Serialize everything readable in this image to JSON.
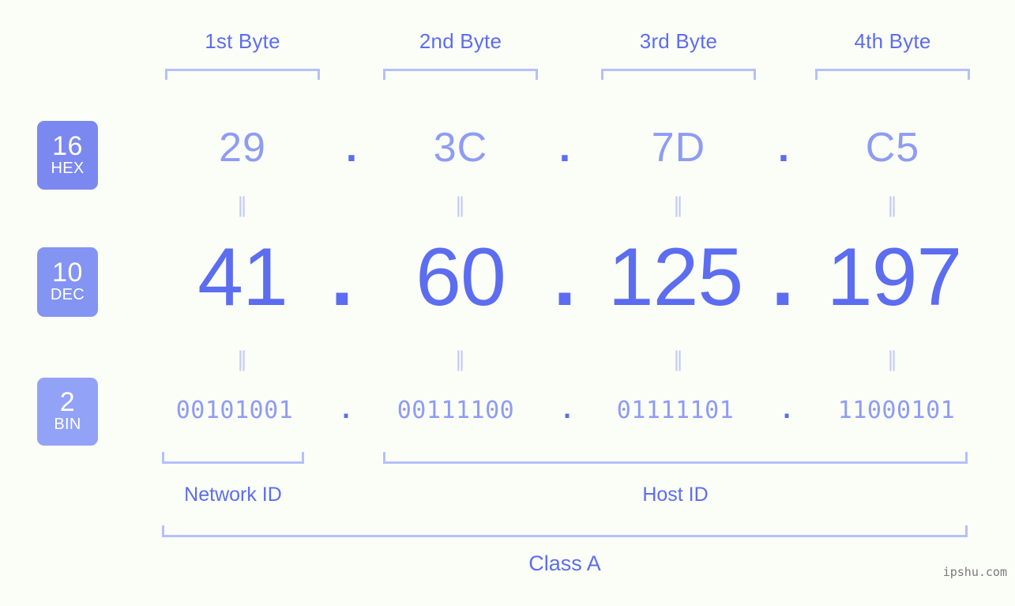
{
  "headers": [
    {
      "label": "1st Byte"
    },
    {
      "label": "2nd Byte"
    },
    {
      "label": "3rd Byte"
    },
    {
      "label": "4th Byte"
    }
  ],
  "bases": [
    {
      "num": "16",
      "abbr": "HEX",
      "color": "#7b88ef"
    },
    {
      "num": "10",
      "abbr": "DEC",
      "color": "#8494f2"
    },
    {
      "num": "2",
      "abbr": "BIN",
      "color": "#92a3f7"
    }
  ],
  "rows": {
    "hex": {
      "values": [
        "29",
        "3C",
        "7D",
        "C5"
      ],
      "separator": "."
    },
    "dec": {
      "values": [
        "41",
        "60",
        "125",
        "197"
      ],
      "separator": "."
    },
    "bin": {
      "values": [
        "00101001",
        "00111100",
        "01111101",
        "11000101"
      ],
      "separator": "."
    }
  },
  "equals_mark": "‖",
  "segments": {
    "network_id": "Network ID",
    "host_id": "Host ID",
    "class": "Class A"
  },
  "watermark": "ipshu.com",
  "colors": {
    "background": "#fbfdf7",
    "accent": "#5c6df0",
    "accent_light": "#8e9cf2",
    "bracket": "#b5c0fb",
    "badge": "#7b88ef",
    "watermark": "#7b7b7b"
  }
}
